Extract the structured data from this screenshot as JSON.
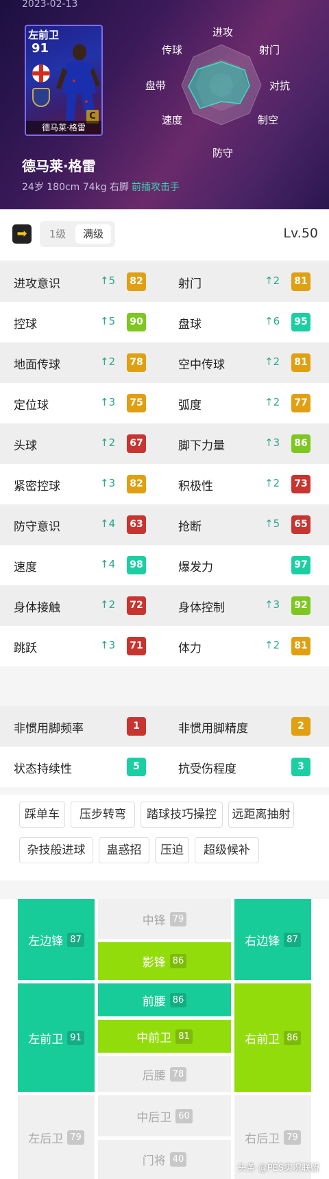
{
  "header": {
    "date": "2023-02-13",
    "card": {
      "position": "左前卫",
      "rating": "91",
      "tier": "C",
      "name": "德马莱·格雷"
    },
    "player_name": "德马莱·格雷",
    "info": "24岁 180cm 74kg 右脚",
    "role": "前插攻击手",
    "radar_labels": [
      "进攻",
      "射门",
      "对抗",
      "制空",
      "防守",
      "速度",
      "盘带",
      "传球"
    ]
  },
  "toolbar": {
    "level_option_1": "1级",
    "level_option_2": "满级",
    "level_label": "Lv.50"
  },
  "stats": [
    {
      "left": {
        "name": "进攻意识",
        "up": "5",
        "value": "82",
        "color": "#e0a012"
      },
      "right": {
        "name": "射门",
        "up": "2",
        "value": "81",
        "color": "#e0a012"
      }
    },
    {
      "left": {
        "name": "控球",
        "up": "5",
        "value": "90",
        "color": "#7ec71f"
      },
      "right": {
        "name": "盘球",
        "up": "6",
        "value": "95",
        "color": "#1ccfa3"
      }
    },
    {
      "left": {
        "name": "地面传球",
        "up": "2",
        "value": "78",
        "color": "#e0a012"
      },
      "right": {
        "name": "空中传球",
        "up": "2",
        "value": "81",
        "color": "#e0a012"
      }
    },
    {
      "left": {
        "name": "定位球",
        "up": "3",
        "value": "75",
        "color": "#e0a012"
      },
      "right": {
        "name": "弧度",
        "up": "2",
        "value": "77",
        "color": "#e0a012"
      }
    },
    {
      "left": {
        "name": "头球",
        "up": "2",
        "value": "67",
        "color": "#c8342f"
      },
      "right": {
        "name": "脚下力量",
        "up": "3",
        "value": "86",
        "color": "#7ec71f"
      }
    },
    {
      "left": {
        "name": "紧密控球",
        "up": "3",
        "value": "82",
        "color": "#e0a012"
      },
      "right": {
        "name": "积极性",
        "up": "2",
        "value": "73",
        "color": "#c8342f"
      }
    },
    {
      "left": {
        "name": "防守意识",
        "up": "4",
        "value": "63",
        "color": "#c8342f"
      },
      "right": {
        "name": "抢断",
        "up": "5",
        "value": "65",
        "color": "#c8342f"
      }
    },
    {
      "left": {
        "name": "速度",
        "up": "4",
        "value": "98",
        "color": "#1ccfa3"
      },
      "right": {
        "name": "爆发力",
        "up": "",
        "value": "97",
        "color": "#1ccfa3"
      }
    },
    {
      "left": {
        "name": "身体接触",
        "up": "2",
        "value": "72",
        "color": "#c8342f"
      },
      "right": {
        "name": "身体控制",
        "up": "3",
        "value": "92",
        "color": "#7ec71f"
      }
    },
    {
      "left": {
        "name": "跳跃",
        "up": "3",
        "value": "71",
        "color": "#c8342f"
      },
      "right": {
        "name": "体力",
        "up": "2",
        "value": "81",
        "color": "#e0a012"
      }
    }
  ],
  "misc": [
    {
      "left": {
        "name": "非惯用脚频率",
        "value": "1",
        "color": "#c8342f"
      },
      "right": {
        "name": "非惯用脚精度",
        "value": "2",
        "color": "#e0a012"
      }
    },
    {
      "left": {
        "name": "状态持续性",
        "value": "5",
        "color": "#1ccfa3"
      },
      "right": {
        "name": "抗受伤程度",
        "value": "3",
        "color": "#1ccfa3"
      }
    }
  ],
  "skills": [
    "踩单车",
    "压步转弯",
    "踏球技巧操控",
    "远距离抽射",
    "杂技般进球",
    "蛊惑招",
    "压迫",
    "超级候补"
  ],
  "positions": {
    "lwf": {
      "label": "左边锋",
      "value": "87"
    },
    "cf": {
      "label": "中锋",
      "value": "79"
    },
    "rwf": {
      "label": "右边锋",
      "value": "87"
    },
    "ss": {
      "label": "影锋",
      "value": "86"
    },
    "lmf": {
      "label": "左前卫",
      "value": "91"
    },
    "amf": {
      "label": "前腰",
      "value": "86"
    },
    "rmf": {
      "label": "右前卫",
      "value": "86"
    },
    "cmf": {
      "label": "中前卫",
      "value": "81"
    },
    "dmf": {
      "label": "后腰",
      "value": "78"
    },
    "lb": {
      "label": "左后卫",
      "value": "79"
    },
    "cb": {
      "label": "中后卫",
      "value": "60"
    },
    "rb": {
      "label": "右后卫",
      "value": "79"
    },
    "gk": {
      "label": "门将",
      "value": "40"
    }
  },
  "watermark": "头条 @PES实况联盟"
}
